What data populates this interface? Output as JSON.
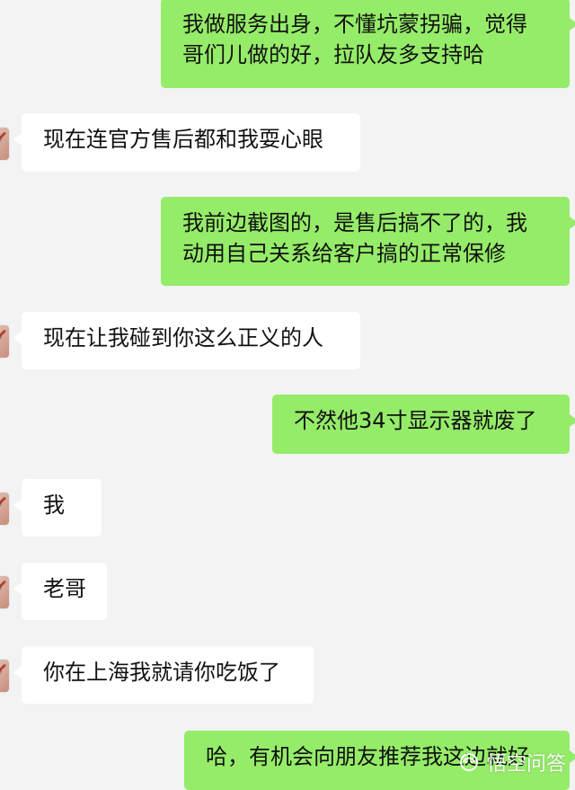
{
  "chat": {
    "messages": [
      {
        "direction": "outgoing",
        "lines": [
          "我做服务出身，不懂坑蒙拐骗，觉得",
          "哥们儿做的好，拉队友多支持哈"
        ]
      },
      {
        "direction": "incoming",
        "lines": [
          "现在连官方售后都和我耍心眼"
        ]
      },
      {
        "direction": "outgoing",
        "lines": [
          "我前边截图的，是售后搞不了的，我",
          "动用自己关系给客户搞的正常保修"
        ]
      },
      {
        "direction": "incoming",
        "lines": [
          "现在让我碰到你这么正义的人"
        ]
      },
      {
        "direction": "outgoing",
        "lines": [
          "不然他34寸显示器就废了"
        ]
      },
      {
        "direction": "incoming",
        "lines": [
          "我"
        ]
      },
      {
        "direction": "incoming",
        "lines": [
          "老哥"
        ]
      },
      {
        "direction": "incoming",
        "lines": [
          "你在上海我就请你吃饭了"
        ]
      },
      {
        "direction": "outgoing",
        "lines": [
          "哈，有机会向朋友推荐我这边就好"
        ]
      }
    ]
  },
  "watermark": {
    "text": "悟空问答",
    "icon": "wukong-logo-icon"
  },
  "colors": {
    "background": "#f3f3f3",
    "incoming_bubble": "#ffffff",
    "outgoing_bubble": "#95ec69",
    "text": "#111111"
  }
}
